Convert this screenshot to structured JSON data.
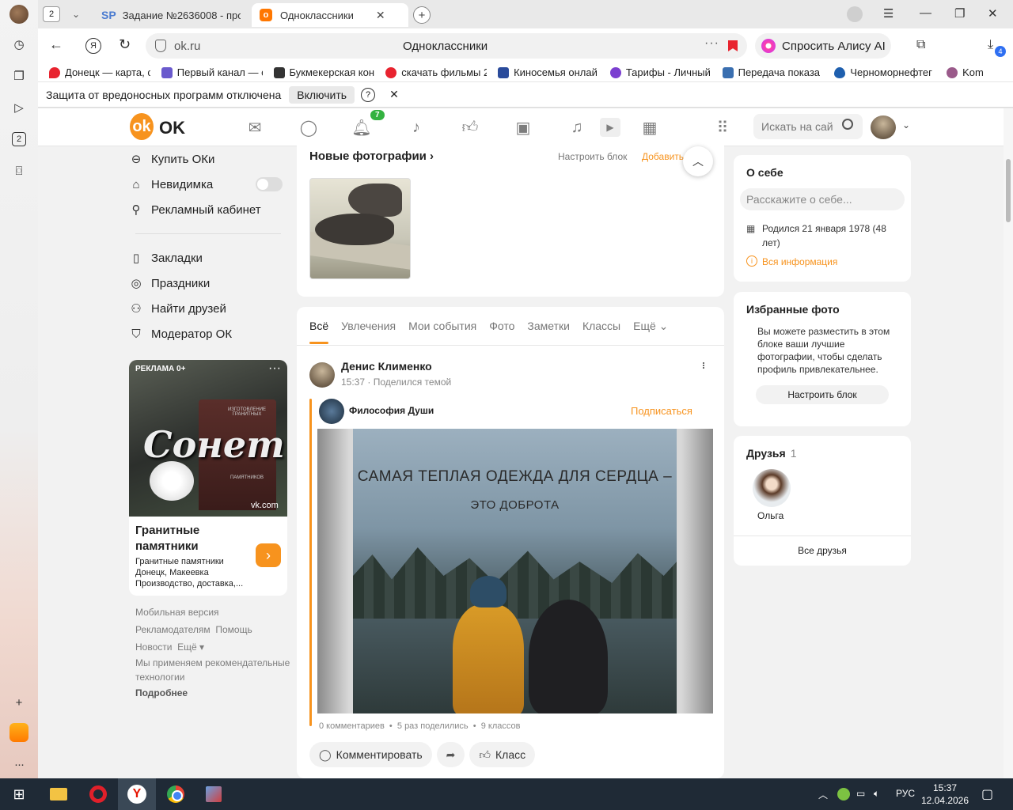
{
  "browser": {
    "tab_count": "2",
    "tabs": [
      {
        "label": "Задание №2636008 - про",
        "favicon": "SP"
      },
      {
        "label": "Одноклассники",
        "favicon": "ok-icon"
      }
    ],
    "url": "ok.ru",
    "page_title": "Одноклассники",
    "alice_button": "Спросить Алису AI",
    "downloads_badge": "4",
    "bookmarks": [
      {
        "label": "Донецк — карта, с",
        "icon": "map-pin-icon",
        "color": "#e8232f"
      },
      {
        "label": "Первый канал — с",
        "icon": "tv-icon",
        "color": "#6a5acd"
      },
      {
        "label": "Букмекерская кон",
        "icon": "bet-icon",
        "color": "#333333"
      },
      {
        "label": "скачать фильмы 2",
        "icon": "yandex-icon",
        "color": "#e8232f"
      },
      {
        "label": "Киносемья онлай",
        "icon": "monitor-icon",
        "color": "#2a4b9b"
      },
      {
        "label": "Тарифы - Личный",
        "icon": "tariff-icon",
        "color": "#7b3fd0"
      },
      {
        "label": "Передача показа",
        "icon": "meter-icon",
        "color": "#3a6fb0"
      },
      {
        "label": "Черноморнефтег",
        "icon": "drop-icon",
        "color": "#1e5fae"
      },
      {
        "label": "Kom",
        "icon": "globe-icon",
        "color": "#9a5a8a"
      }
    ],
    "notice": {
      "text": "Защита от вредоносных программ отключена",
      "button": "Включить",
      "help": "?",
      "close": "✕"
    }
  },
  "ok": {
    "logo_text": "OK",
    "notifications_badge": "7",
    "search_placeholder": "Искать на сай",
    "left_nav": [
      {
        "label": "Купить ОКи",
        "icon": "coin-icon"
      },
      {
        "label": "Невидимка",
        "icon": "incognito-icon"
      },
      {
        "label": "Рекламный кабинет",
        "icon": "megaphone-icon"
      },
      {
        "label": "Закладки",
        "icon": "bookmark-icon"
      },
      {
        "label": "Праздники",
        "icon": "balloon-icon"
      },
      {
        "label": "Найти друзей",
        "icon": "add-friend-icon"
      },
      {
        "label": "Модератор ОК",
        "icon": "shield-icon"
      }
    ],
    "ad": {
      "tag": "РЕКЛАМА 0+",
      "img_label": "ИЗГОТОВЛЕНИЕ ГРАНИТНЫХ",
      "img_brand": "Сонет",
      "img_sub": "ПАМЯТНИКОВ",
      "domain": "vk.com",
      "title": "Гранитные памятники",
      "desc": "Гранитные памятники Донецк, Макеевка Производство, доставка,..."
    },
    "footer": {
      "mobile": "Мобильная версия",
      "advertisers": "Рекламодателям",
      "help": "Помощь",
      "news": "Новости",
      "more": "Ещё",
      "recs": "Мы применяем рекомендательные технологии",
      "details": "Подробнее"
    },
    "new_photos": {
      "title": "Новые фотографии",
      "configure": "Настроить блок",
      "add": "Добавить"
    },
    "feed_tabs": [
      "Всё",
      "Увлечения",
      "Мои события",
      "Фото",
      "Заметки",
      "Классы",
      "Ещё"
    ],
    "post": {
      "author": "Денис Клименко",
      "time": "15:37",
      "action": "Поделился темой",
      "group": "Философия Души",
      "subscribe": "Подписаться",
      "image_line1": "САМАЯ ТЕПЛАЯ ОДЕЖДА ДЛЯ СЕРДЦА –",
      "image_line2": "ЭТО ДОБРОТА",
      "comments": "0 комментариев",
      "shares": "5 раз поделились",
      "likes": "9 классов",
      "comment_button": "Комментировать",
      "like_button": "Класс"
    },
    "about": {
      "title": "О себе",
      "placeholder": "Расскажите о себе...",
      "born": "Родился 21 января 1978 (48 лет)",
      "all_info": "Вся информация"
    },
    "fav_photos": {
      "title": "Избранные фото",
      "text": "Вы можете разместить в этом блоке ваши лучшие фотографии, чтобы сделать профиль привлекательнее.",
      "button": "Настроить блок"
    },
    "friends": {
      "title": "Друзья",
      "count": "1",
      "items": [
        {
          "name": "Ольга"
        }
      ],
      "all": "Все друзья"
    }
  },
  "taskbar": {
    "language": "РУС",
    "time": "15:37",
    "date": "12.04.2026"
  },
  "colors": {
    "ok_orange": "#f7931e",
    "green_badge": "#33b240"
  }
}
